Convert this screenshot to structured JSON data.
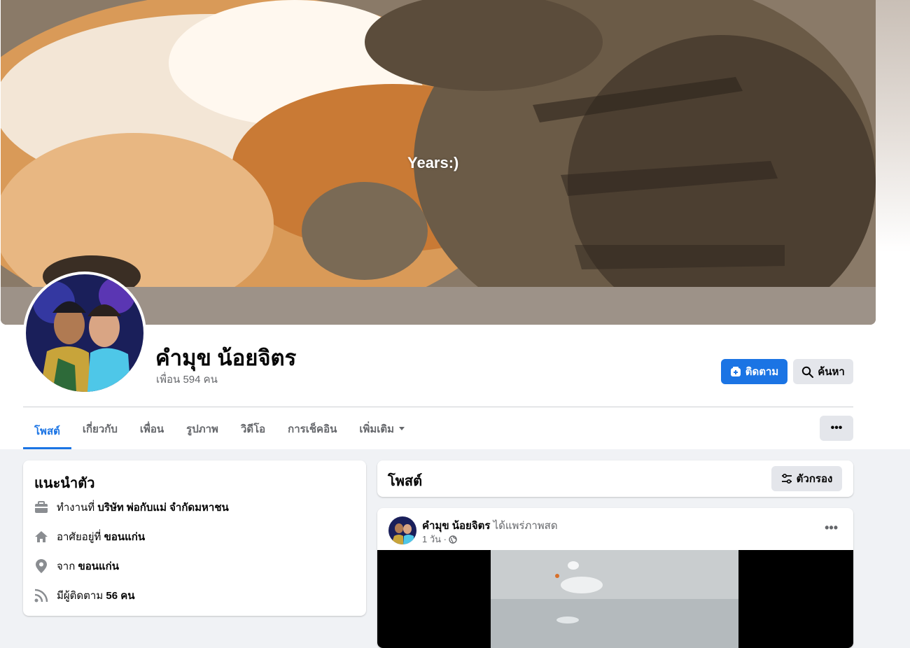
{
  "profile": {
    "name": "คำมุข น้อยจิตร",
    "friends": "เพื่อน 594 คน",
    "cover_caption": "Years:)"
  },
  "actions": {
    "follow": "ติดตาม",
    "search": "ค้นหา",
    "more": "•••"
  },
  "tabs": [
    {
      "label": "โพสต์",
      "active": true
    },
    {
      "label": "เกี่ยวกับ"
    },
    {
      "label": "เพื่อน"
    },
    {
      "label": "รูปภาพ"
    },
    {
      "label": "วิดีโอ"
    },
    {
      "label": "การเช็คอิน"
    },
    {
      "label": "เพิ่มเติม"
    }
  ],
  "intro": {
    "title": "แนะนำตัว",
    "work": {
      "prefix": "ทำงานที่",
      "value": "บริษัท พ่อกับแม่ จำกัดมหาชน"
    },
    "lives": {
      "prefix": "อาศัยอยู่ที่",
      "value": "ขอนแก่น"
    },
    "from": {
      "prefix": "จาก",
      "value": "ขอนแก่น"
    },
    "followers": {
      "prefix": "มีผู้ติดตาม",
      "value": "56 คน"
    }
  },
  "posts": {
    "title": "โพสต์",
    "filter": "ตัวกรอง"
  },
  "post": {
    "author": "คำมุข น้อยจิตร",
    "action": "ได้แพร่ภาพสด",
    "time": "1 วัน ·",
    "more": "•••"
  },
  "colors": {
    "accent": "#1b74e4",
    "background": "#f0f2f5",
    "secondary_text": "#65676b"
  },
  "icons": {
    "follow": "add-person-icon",
    "search": "search-icon",
    "work": "briefcase-icon",
    "home": "home-icon",
    "location": "location-pin-icon",
    "followers": "rss-icon",
    "filter": "sliders-icon",
    "privacy": "globe-icon",
    "dropdown": "caret-down-icon"
  }
}
